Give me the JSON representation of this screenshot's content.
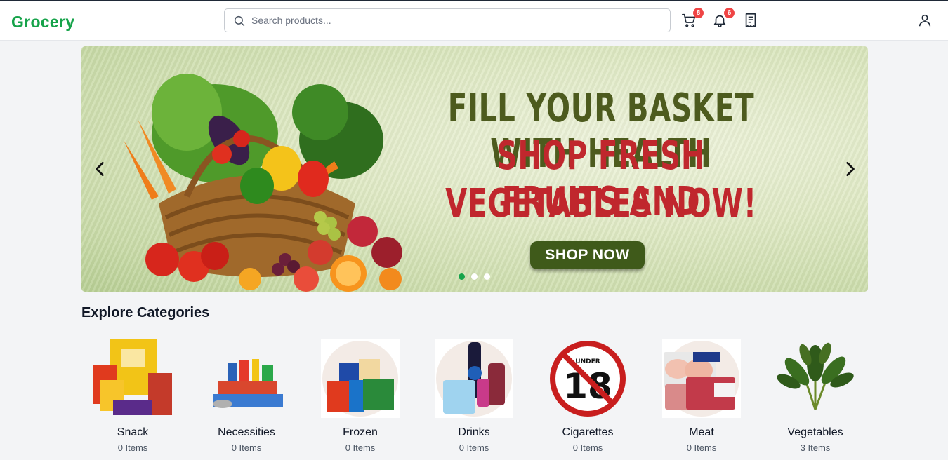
{
  "header": {
    "logo": "Grocery",
    "search_placeholder": "Search products...",
    "cart_count": "8",
    "notification_count": "6"
  },
  "banner": {
    "line1": "FILL YOUR BASKET WITH HEALTH",
    "line2": "SHOP FRESH FRUITS AND",
    "line3": "VEGETABLES NOW!",
    "cta": "SHOP NOW",
    "active_slide": 1,
    "slide_count": 3
  },
  "categories": {
    "title": "Explore Categories",
    "items": [
      {
        "name": "Snack",
        "count": "0 Items"
      },
      {
        "name": "Necessities",
        "count": "0 Items"
      },
      {
        "name": "Frozen",
        "count": "0 Items"
      },
      {
        "name": "Drinks",
        "count": "0 Items"
      },
      {
        "name": "Cigarettes",
        "count": "0 Items"
      },
      {
        "name": "Meat",
        "count": "0 Items"
      },
      {
        "name": "Vegetables",
        "count": "3 Items"
      }
    ]
  },
  "colors": {
    "brand": "#16a34a",
    "badge": "#ef4444",
    "headline_green": "#4d5b1e",
    "headline_red": "#c0272d",
    "cta_bg": "#3f5a1a"
  }
}
